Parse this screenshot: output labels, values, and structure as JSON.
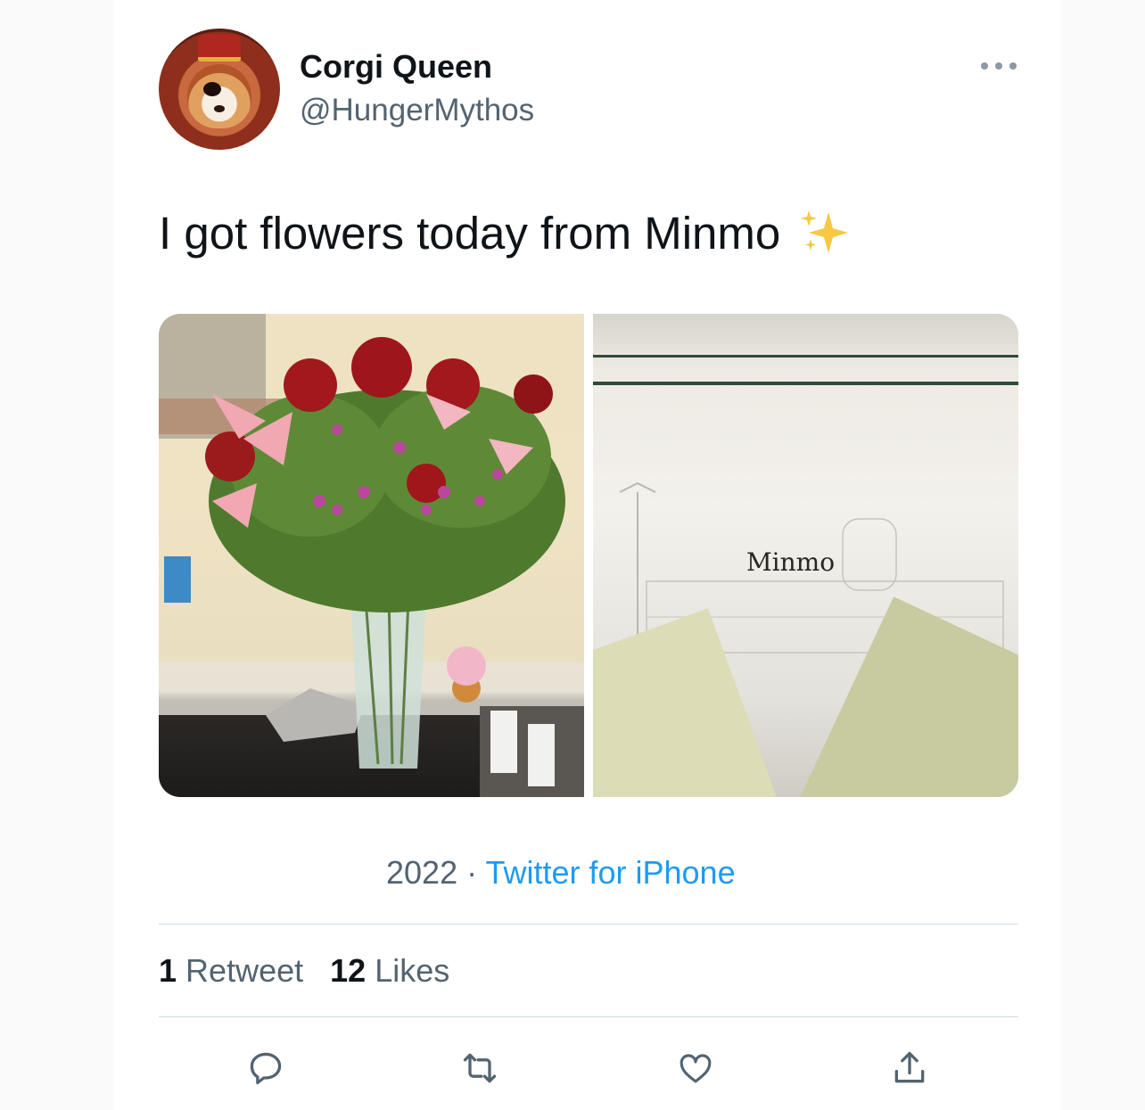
{
  "author": {
    "display_name": "Corgi Queen",
    "handle": "@HungerMythos"
  },
  "tweet": {
    "text": "I got flowers today from Minmo",
    "emoji": "sparkles-icon",
    "media": [
      {
        "name": "flowers-photo",
        "description": "bouquet of roses and lilies in a glass vase"
      },
      {
        "name": "card-photo",
        "card_text": "Minmo"
      }
    ]
  },
  "meta": {
    "date": "2022",
    "separator": "·",
    "source": "Twitter for iPhone"
  },
  "stats": {
    "retweets_count": "1",
    "retweets_label": "Retweet",
    "likes_count": "12",
    "likes_label": "Likes"
  },
  "actions": [
    {
      "icon": "reply-icon"
    },
    {
      "icon": "retweet-icon"
    },
    {
      "icon": "like-icon"
    },
    {
      "icon": "share-icon"
    }
  ],
  "colors": {
    "link": "#1d9bf0",
    "secondary_text": "#536471",
    "primary_text": "#0f1419",
    "divider": "#cfd9de"
  }
}
